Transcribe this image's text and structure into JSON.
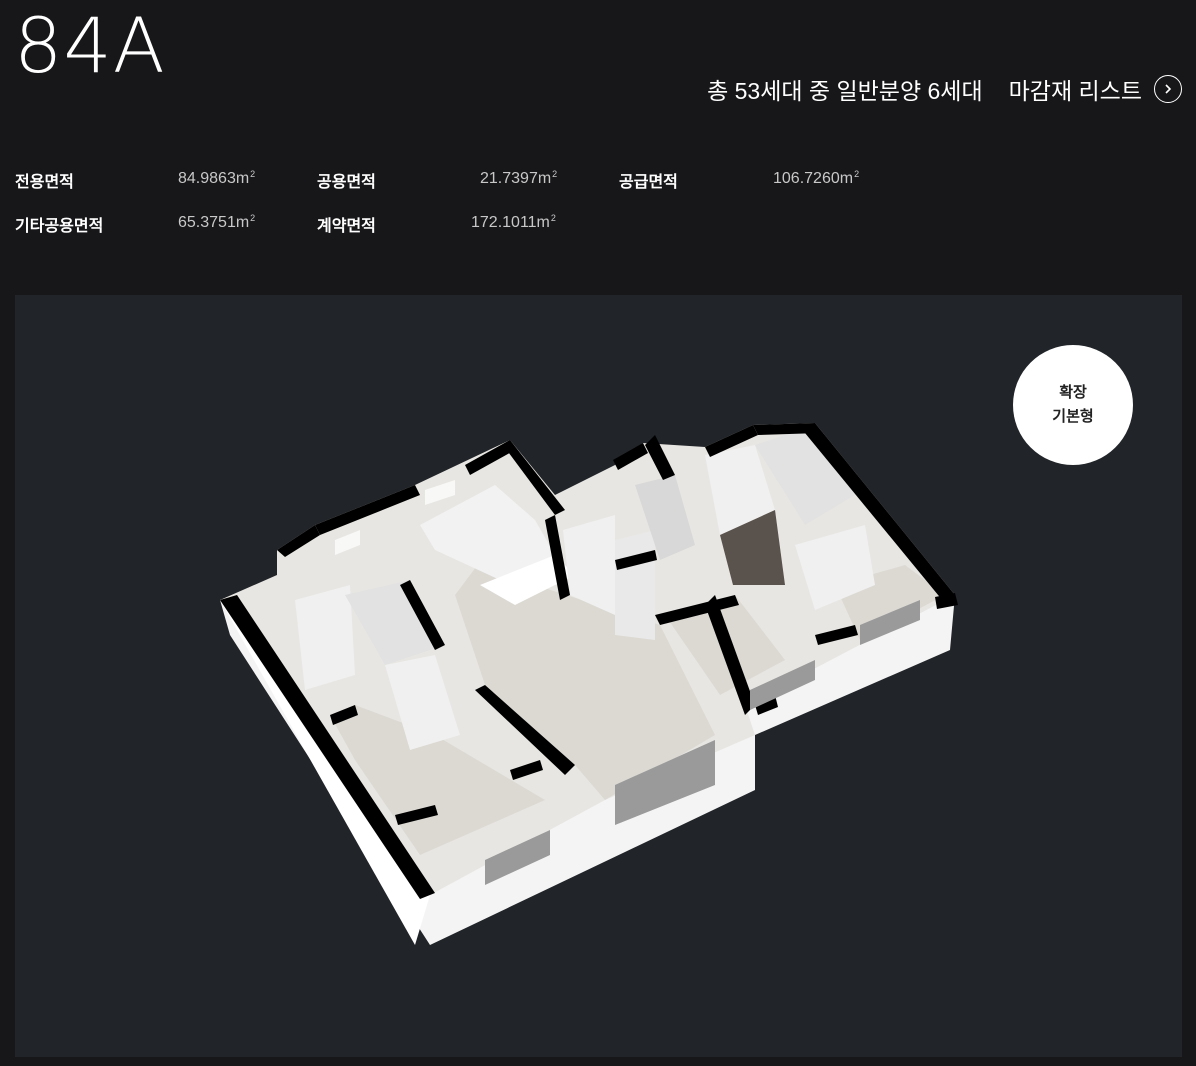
{
  "unit": {
    "type_name": "84A",
    "summary": "총 53세대 중 일반분양 6세대",
    "material_list_label": "마감재 리스트"
  },
  "areas": [
    {
      "label": "전용면적",
      "value": "84.9863m"
    },
    {
      "label": "공용면적",
      "value": "21.7397m"
    },
    {
      "label": "공급면적",
      "value": "106.7260m"
    },
    {
      "label": "기타공용면적",
      "value": "65.3751m"
    },
    {
      "label": "계약면적",
      "value": "172.1011m"
    }
  ],
  "area_unit_superscript": "2",
  "plan": {
    "badge_line1": "확장",
    "badge_line2": "기본형"
  },
  "colors": {
    "background": "#17171a",
    "panel": "#212428",
    "wall": "#000000",
    "floor": "#e6e4e0",
    "badge": "#ffffff"
  },
  "icons": {
    "material_arrow": "chevron-right-circle-icon"
  }
}
